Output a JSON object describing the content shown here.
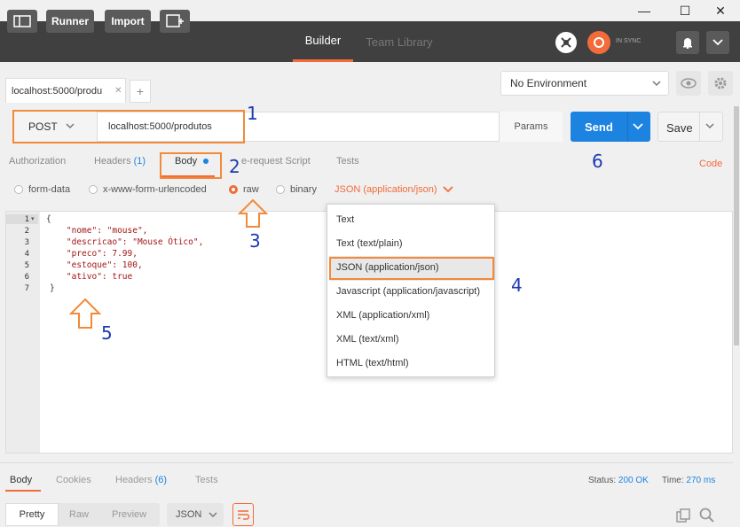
{
  "window": {
    "minimize": "—",
    "maximize": "☐",
    "close": "✕"
  },
  "header": {
    "runner": "Runner",
    "import": "Import",
    "nav_builder": "Builder",
    "nav_team": "Team Library",
    "sync": "IN SYNC"
  },
  "tabs": {
    "request_tab": "localhost:5000/produ",
    "close": "✕",
    "plus": "+"
  },
  "env": {
    "selected": "No Environment"
  },
  "request": {
    "method": "POST",
    "url": "localhost:5000/produtos",
    "params": "Params",
    "send": "Send",
    "save": "Save"
  },
  "subtabs": {
    "authorization": "Authorization",
    "headers": "Headers",
    "headers_count": "(1)",
    "body": "Body",
    "prerequest": "e-request Script",
    "tests": "Tests",
    "code": "Code"
  },
  "body_modes": {
    "formdata": "form-data",
    "urlencoded": "x-www-form-urlencoded",
    "raw": "raw",
    "binary": "binary",
    "type_selected": "JSON (application/json)"
  },
  "editor": {
    "lines": [
      "1",
      "2",
      "3",
      "4",
      "5",
      "6",
      "7"
    ],
    "code": [
      "{",
      "    \"nome\": \"mouse\",",
      "    \"descricao\": \"Mouse Ótico\",",
      "    \"preco\": 7.99,",
      "    \"estoque\": 100,",
      "    \"ativo\": true",
      "}"
    ]
  },
  "dropdown": {
    "items": [
      "Text",
      "Text (text/plain)",
      "JSON (application/json)",
      "Javascript (application/javascript)",
      "XML (application/xml)",
      "XML (text/xml)",
      "HTML (text/html)"
    ]
  },
  "annotations": {
    "a1": "1",
    "a2": "2",
    "a3": "3",
    "a4": "4",
    "a5": "5",
    "a6": "6"
  },
  "response": {
    "body": "Body",
    "cookies": "Cookies",
    "headers": "Headers",
    "headers_count": "(6)",
    "tests": "Tests",
    "status_label": "Status:",
    "status_value": "200 OK",
    "time_label": "Time:",
    "time_value": "270 ms",
    "pretty": "Pretty",
    "raw": "Raw",
    "preview": "Preview",
    "format": "JSON"
  },
  "colors": {
    "accent": "#f26b3a",
    "send": "#1c83e0",
    "annotation": "#1c3ab0",
    "header_bg": "#404040"
  }
}
